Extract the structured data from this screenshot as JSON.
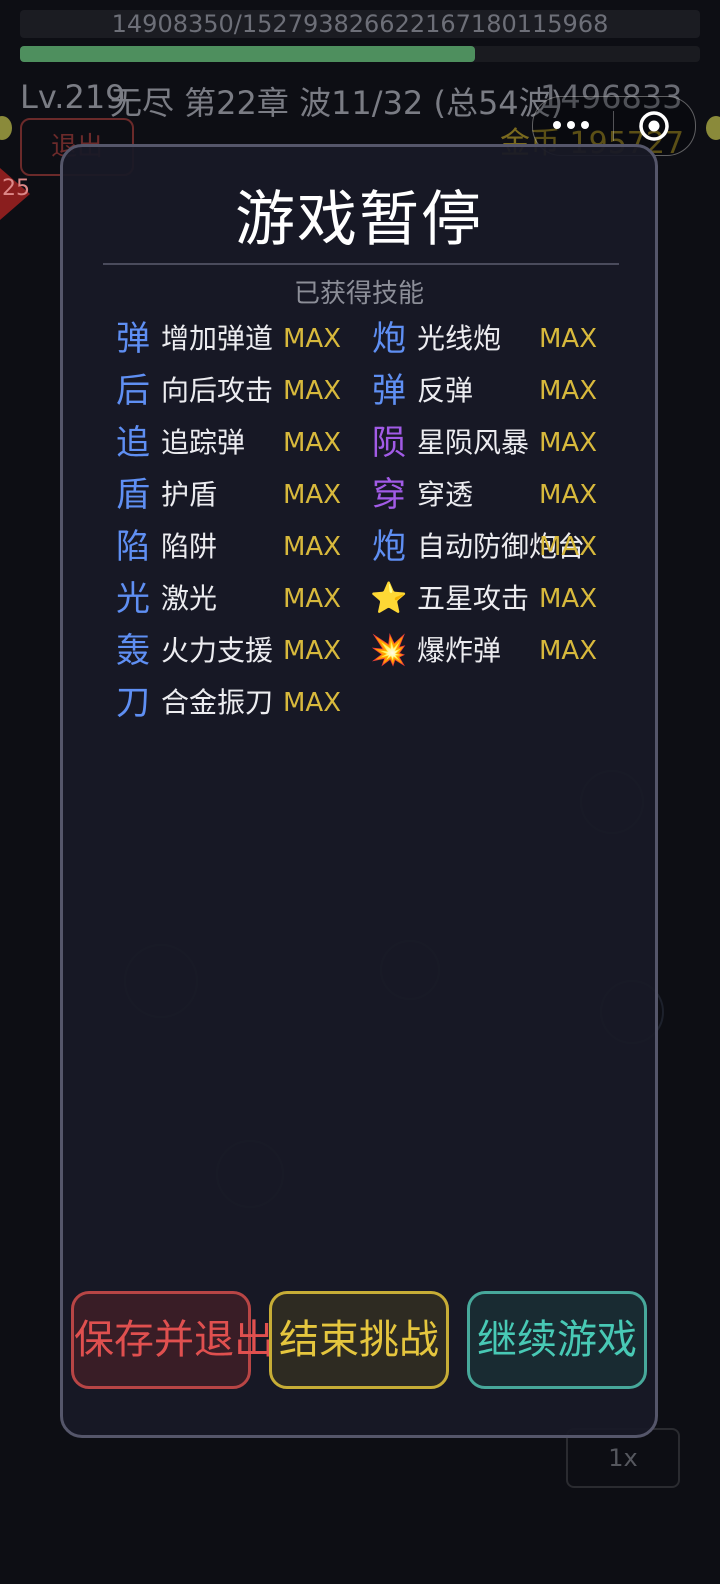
{
  "hud": {
    "xp_text": "14908350/1527938266221671801159​68",
    "level": "Lv.219",
    "mode_chapter": "无尽 第22章 波11/32 (总54波)",
    "score": "1496833",
    "gold": "金币 195727",
    "exit_label": "退出",
    "speed_label": "1x",
    "enemy_badge": "25"
  },
  "modal": {
    "title": "游戏暂停",
    "section_label": "已获得技能",
    "skills_left": [
      {
        "icon": "弹",
        "name": "增加弹道",
        "level": "MAX"
      },
      {
        "icon": "后",
        "name": "向后攻击",
        "level": "MAX"
      },
      {
        "icon": "追",
        "name": "追踪弹",
        "level": "MAX"
      },
      {
        "icon": "盾",
        "name": "护盾",
        "level": "MAX"
      },
      {
        "icon": "陷",
        "name": "陷阱",
        "level": "MAX"
      },
      {
        "icon": "光",
        "name": "激光",
        "level": "MAX"
      },
      {
        "icon": "轰",
        "name": "火力支援",
        "level": "MAX"
      },
      {
        "icon": "刀",
        "name": "合金振刀",
        "level": "MAX"
      }
    ],
    "skills_right": [
      {
        "icon": "炮",
        "name": "光线炮",
        "level": "MAX"
      },
      {
        "icon": "弹",
        "name": "反弹",
        "level": "MAX"
      },
      {
        "icon": "陨",
        "name": "星陨风暴",
        "level": "MAX"
      },
      {
        "icon": "穿",
        "name": "穿透",
        "level": "MAX"
      },
      {
        "icon": "炮",
        "name": "自动防御炮台",
        "level": "MAX"
      },
      {
        "icon": "⭐",
        "name": "五星攻击",
        "level": "MAX"
      },
      {
        "icon": "💥",
        "name": "爆炸弹",
        "level": "MAX"
      }
    ],
    "buttons": {
      "save_exit": "保存并退出",
      "end_challenge": "结束挑战",
      "continue": "继续游戏"
    }
  },
  "colors": {
    "save": "#e0504f",
    "end": "#e5c63e",
    "continue": "#48c9b5",
    "max": "#d8b93c",
    "icon_blue": "#5f8ff3",
    "icon_purple": "#a25be6"
  }
}
